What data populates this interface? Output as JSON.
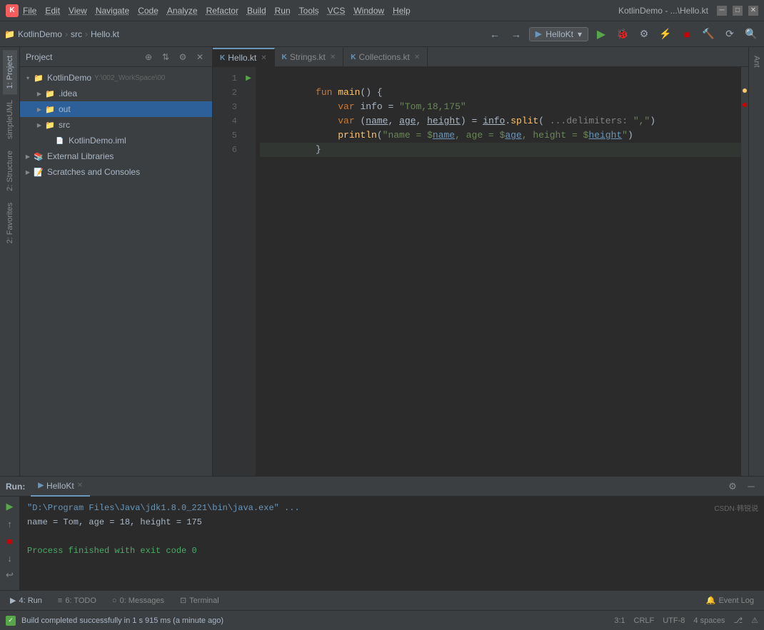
{
  "titlebar": {
    "logo": "K",
    "menu": [
      "File",
      "Edit",
      "View",
      "Navigate",
      "Code",
      "Analyze",
      "Refactor",
      "Build",
      "Run",
      "Tools",
      "VCS",
      "Window",
      "Help"
    ],
    "title": "KotlinDemo - ...\\Hello.kt",
    "controls": [
      "─",
      "□",
      "✕"
    ]
  },
  "toolbar": {
    "breadcrumb": [
      "KotlinDemo",
      "src",
      "Hello.kt"
    ],
    "run_config": "HelloKt",
    "icons": [
      "run",
      "debug",
      "cover",
      "profile",
      "stop",
      "build",
      "reload",
      "search"
    ]
  },
  "sidebar": {
    "tabs": [
      {
        "id": "project",
        "label": "1: Project",
        "active": true
      },
      {
        "id": "simpleuml",
        "label": "simpleUML",
        "active": false
      },
      {
        "id": "structure",
        "label": "2: Structure",
        "active": false
      },
      {
        "id": "favorites",
        "label": "2: Favorites",
        "active": false
      }
    ]
  },
  "project_panel": {
    "title": "Project",
    "tree": [
      {
        "id": "kotlindemo-root",
        "indent": 0,
        "expanded": true,
        "icon": "folder",
        "label": "KotlinDemo",
        "suffix": "Y:\\002_WorkSpace\\00",
        "type": "root"
      },
      {
        "id": "idea",
        "indent": 1,
        "expanded": false,
        "icon": "folder-blue",
        "label": ".idea",
        "type": "folder"
      },
      {
        "id": "out",
        "indent": 1,
        "expanded": false,
        "icon": "folder-yellow",
        "label": "out",
        "type": "folder",
        "highlighted": true
      },
      {
        "id": "src",
        "indent": 1,
        "expanded": false,
        "icon": "folder-src",
        "label": "src",
        "type": "folder"
      },
      {
        "id": "kotlindemo-iml",
        "indent": 1,
        "expanded": false,
        "icon": "iml",
        "label": "KotlinDemo.iml",
        "type": "file"
      },
      {
        "id": "external-libraries",
        "indent": 0,
        "expanded": false,
        "icon": "ext",
        "label": "External Libraries",
        "type": "libraries"
      },
      {
        "id": "scratches",
        "indent": 0,
        "expanded": false,
        "icon": "scratch",
        "label": "Scratches and Consoles",
        "type": "scratches"
      }
    ]
  },
  "editor": {
    "tabs": [
      {
        "id": "hello-kt",
        "label": "Hello.kt",
        "active": true,
        "icon": "K",
        "closable": true
      },
      {
        "id": "strings-kt",
        "label": "Strings.kt",
        "active": false,
        "icon": "K",
        "closable": true
      },
      {
        "id": "collections-kt",
        "label": "Collections.kt",
        "active": false,
        "icon": "K",
        "closable": true
      }
    ],
    "code": [
      {
        "line": 1,
        "content": "fun main() {",
        "has_run": true
      },
      {
        "line": 2,
        "content": "    var info = \"Tom,18,175\"",
        "has_run": false
      },
      {
        "line": 3,
        "content": "    var (name, age, height) = info.split( ...delimiters: \",\")",
        "has_run": false
      },
      {
        "line": 4,
        "content": "    println(\"name = $name, age = $age, height = $height\")",
        "has_run": false
      },
      {
        "line": 5,
        "content": "}",
        "has_run": false
      },
      {
        "line": 6,
        "content": "",
        "has_run": false
      }
    ]
  },
  "run_panel": {
    "label": "Run:",
    "tabs": [
      {
        "id": "hellokr",
        "label": "HelloKt",
        "active": true,
        "closable": true
      }
    ],
    "output": [
      {
        "text": "\"D:\\Program Files\\Java\\jdk1.8.0_221\\bin\\java.exe\" ...",
        "type": "path"
      },
      {
        "text": "name = Tom, age = 18, height = 175",
        "type": "result"
      },
      {
        "text": "",
        "type": "blank"
      },
      {
        "text": "Process finished with exit code 0",
        "type": "success"
      }
    ]
  },
  "status_bar": {
    "build_text": "Build completed successfully in 1 s 915 ms (a minute ago)",
    "position": "3:1",
    "line_ending": "CRLF",
    "encoding": "UTF-8",
    "indent": "4 spaces"
  },
  "bottom_toolbar": {
    "tools": [
      {
        "id": "run",
        "label": "4: Run",
        "icon": "▶",
        "active": true
      },
      {
        "id": "todo",
        "label": "6: TODO",
        "icon": "≡"
      },
      {
        "id": "messages",
        "label": "0: Messages",
        "icon": "○"
      },
      {
        "id": "terminal",
        "label": "Terminal",
        "icon": "⊡"
      }
    ],
    "event_log": "Event Log"
  },
  "watermark": "CSDN·韩锐说"
}
